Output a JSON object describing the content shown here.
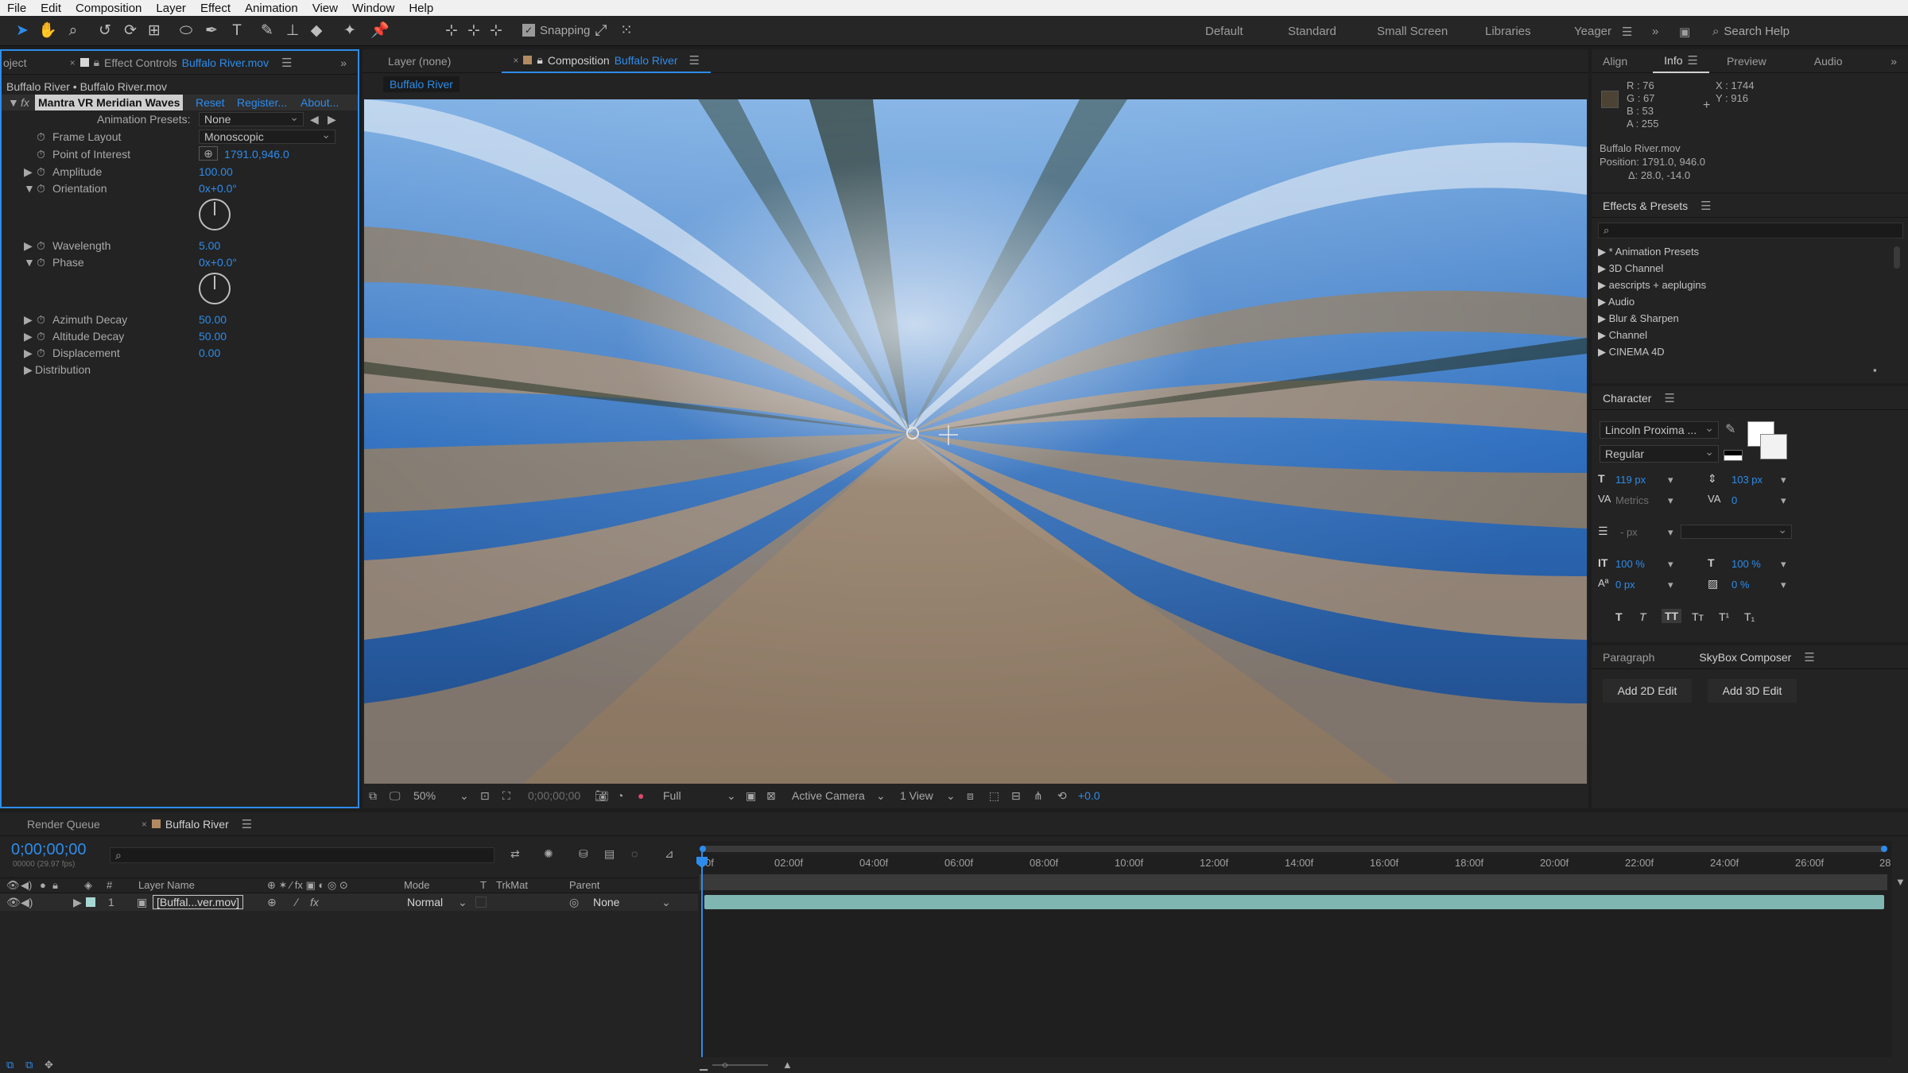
{
  "menu": [
    "File",
    "Edit",
    "Composition",
    "Layer",
    "Effect",
    "Animation",
    "View",
    "Window",
    "Help"
  ],
  "toolbar": {
    "snapping_label": "Snapping",
    "workspaces": [
      "Default",
      "Standard",
      "Small Screen",
      "Libraries",
      "Yeager"
    ],
    "search_help": "Search Help"
  },
  "effect_panel": {
    "tab_project": "oject",
    "tab_prefix": "Effect Controls",
    "tab_file": "Buffalo River.mov",
    "breadcrumb": "Buffalo River • Buffalo River.mov",
    "effect_name": "Mantra VR Meridian Waves",
    "reset": "Reset",
    "register": "Register...",
    "about": "About...",
    "presets_label": "Animation Presets:",
    "presets_value": "None",
    "params": [
      {
        "label": "Frame Layout",
        "value": "Monoscopic"
      },
      {
        "label": "Point of Interest",
        "value": "1791.0,946.0"
      },
      {
        "label": "Amplitude",
        "value": "100.00"
      },
      {
        "label": "Orientation",
        "value": "0x+0.0°"
      },
      {
        "label": "Wavelength",
        "value": "5.00"
      },
      {
        "label": "Phase",
        "value": "0x+0.0°"
      },
      {
        "label": "Azimuth Decay",
        "value": "50.00"
      },
      {
        "label": "Altitude Decay",
        "value": "50.00"
      },
      {
        "label": "Displacement",
        "value": "0.00"
      },
      {
        "label": "Distribution",
        "value": ""
      }
    ]
  },
  "viewer": {
    "tab_layer": "Layer (none)",
    "tab_comp_prefix": "Composition",
    "tab_comp_name": "Buffalo River",
    "subtab": "Buffalo River",
    "zoom": "50%",
    "timecode": "0;00;00;00",
    "resolution": "Full",
    "camera": "Active Camera",
    "views": "1 View",
    "exposure": "+0.0"
  },
  "info_panel": {
    "tabs": [
      "Align",
      "Info",
      "Preview",
      "Audio"
    ],
    "r": "R : 76",
    "g": "G : 67",
    "b": "B : 53",
    "a": "A : 255",
    "x": "X : 1744",
    "y": "Y : 916",
    "source": "Buffalo River.mov",
    "position": "Position: 1791.0, 946.0",
    "delta": "Δ: 28.0, -14.0",
    "pixel_color": "#4c4335"
  },
  "effects_presets": {
    "title": "Effects & Presets",
    "items": [
      "* Animation Presets",
      "3D Channel",
      "aescripts + aeplugins",
      "Audio",
      "Blur & Sharpen",
      "Channel",
      "CINEMA 4D"
    ]
  },
  "character": {
    "title": "Character",
    "font": "Lincoln Proxima ...",
    "style": "Regular",
    "size": "119 px",
    "leading": "103 px",
    "kerning": "Metrics",
    "tracking": "0",
    "stroke": "- px",
    "vscale": "100 %",
    "hscale": "100 %",
    "baseline": "0 px",
    "tsume": "0 %",
    "style_buttons": [
      "T",
      "T",
      "TT",
      "Tт",
      "T¹",
      "T₁"
    ]
  },
  "skybox": {
    "tab_paragraph": "Paragraph",
    "tab_skybox": "SkyBox Composer",
    "btn_2d": "Add 2D Edit",
    "btn_3d": "Add 3D Edit"
  },
  "timeline": {
    "tab_render": "Render Queue",
    "tab_comp": "Buffalo River",
    "timecode": "0;00;00;00",
    "frames": "00000 (29.97 fps)",
    "columns": {
      "hash": "#",
      "layer_name": "Layer Name",
      "mode": "Mode",
      "t": "T",
      "trkmat": "TrkMat",
      "parent": "Parent"
    },
    "layer": {
      "index": "1",
      "name": "[Buffal...ver.mov]",
      "mode": "Normal",
      "parent": "None"
    },
    "ruler": [
      "0f",
      "02:00f",
      "04:00f",
      "06:00f",
      "08:00f",
      "10:00f",
      "12:00f",
      "14:00f",
      "16:00f",
      "18:00f",
      "20:00f",
      "22:00f",
      "24:00f",
      "26:00f",
      "28"
    ]
  }
}
